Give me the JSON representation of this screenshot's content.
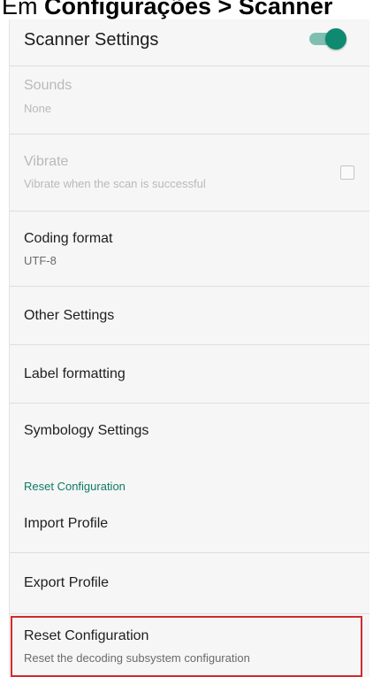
{
  "caption": {
    "prefix": "Em ",
    "bold": "Configurações > Scanner"
  },
  "header": {
    "title": "Scanner Settings",
    "toggle_on": true
  },
  "items": {
    "sounds": {
      "title": "Sounds",
      "subtitle": "None"
    },
    "vibrate": {
      "title": "Vibrate",
      "subtitle": "Vibrate when the scan is successful",
      "checked": false
    },
    "coding_format": {
      "title": "Coding format",
      "subtitle": "UTF-8"
    },
    "other_settings": {
      "title": "Other Settings"
    },
    "label_formatting": {
      "title": "Label formatting"
    },
    "symbology_settings": {
      "title": "Symbology Settings"
    },
    "section_reset": {
      "title": "Reset Configuration"
    },
    "import_profile": {
      "title": "Import Profile"
    },
    "export_profile": {
      "title": "Export Profile"
    },
    "reset_configuration": {
      "title": "Reset Configuration",
      "subtitle": "Reset the decoding subsystem configuration"
    }
  },
  "colors": {
    "accent": "#0e8a70",
    "highlight": "#d22b2b"
  }
}
